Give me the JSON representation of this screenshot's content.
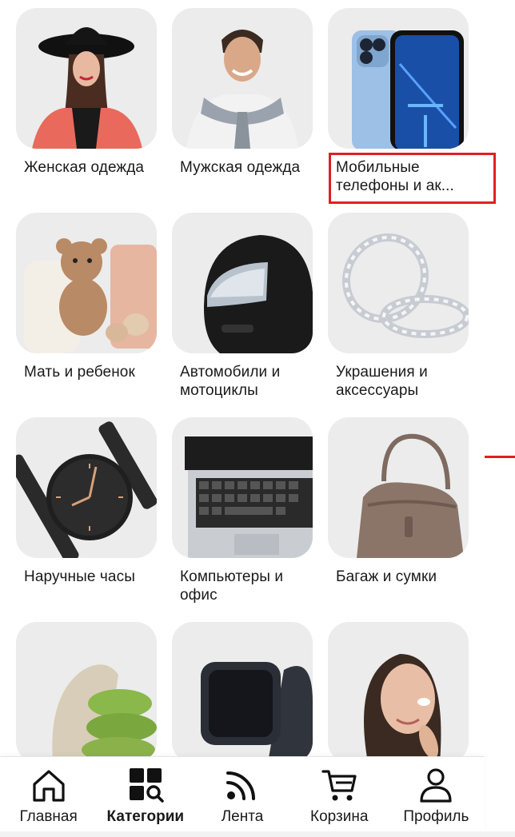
{
  "categories": [
    {
      "label": "Женская одежда",
      "image": "woman-in-hat"
    },
    {
      "label": "Мужская одежда",
      "image": "man-with-sweater"
    },
    {
      "label": "Мобильные телефоны и ак...",
      "image": "smartphone"
    },
    {
      "label": "Мать и ребенок",
      "image": "teddy-bear"
    },
    {
      "label": "Автомобили и мотоциклы",
      "image": "motorcycle-helmet"
    },
    {
      "label": "Украшения и аксессуары",
      "image": "diamond-rings"
    },
    {
      "label": "Наручные часы",
      "image": "wristwatch"
    },
    {
      "label": "Компьютеры и офис",
      "image": "laptop"
    },
    {
      "label": "Багаж и сумки",
      "image": "handbag"
    },
    {
      "label": "",
      "image": "pillows-and-blanket"
    },
    {
      "label": "",
      "image": "smartwatch"
    },
    {
      "label": "",
      "image": "woman-skincare"
    }
  ],
  "tabbar": {
    "items": [
      {
        "label": "Главная",
        "icon": "home-icon",
        "active": false
      },
      {
        "label": "Категории",
        "icon": "categories-icon",
        "active": true
      },
      {
        "label": "Лента",
        "icon": "feed-icon",
        "active": false
      },
      {
        "label": "Корзина",
        "icon": "cart-icon",
        "active": false
      },
      {
        "label": "Профиль",
        "icon": "profile-icon",
        "active": false
      }
    ]
  },
  "colors": {
    "highlight": "#e02020",
    "tile_bg": "#ececec"
  }
}
